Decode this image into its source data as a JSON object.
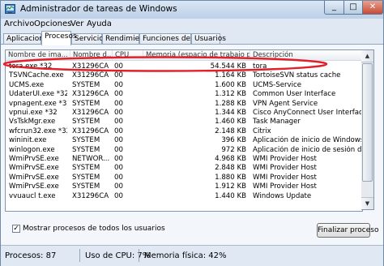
{
  "window": {
    "title": "Administrador de tareas de Windows",
    "controls": [
      "_",
      "□",
      "✕"
    ]
  },
  "menu": [
    "Archivo",
    "Opciones",
    "Ver",
    "Ayuda"
  ],
  "tabs": [
    {
      "label": "Aplicaciones",
      "active": false
    },
    {
      "label": "Procesos",
      "active": true
    },
    {
      "label": "Servicios",
      "active": false
    },
    {
      "label": "Rendimiento",
      "active": false
    },
    {
      "label": "Funciones de red",
      "active": false
    },
    {
      "label": "Usuarios",
      "active": false
    }
  ],
  "columns": [
    "Nombre de ima...",
    "Nombre d...",
    "CPU",
    "Memoria (espacio de trabajo privado)",
    "Descripción"
  ],
  "processes": [
    {
      "name": "tora.exe *32",
      "user": "X31296CA",
      "cpu": "00",
      "memory": "54.544 KB",
      "description": "tora",
      "circled": true
    },
    {
      "name": "TSVNCache.exe",
      "user": "X31296CA",
      "cpu": "00",
      "memory": "1.164 KB",
      "description": "TortoiseSVN status cache"
    },
    {
      "name": "UCMS.exe",
      "user": "SYSTEM",
      "cpu": "00",
      "memory": "1.600 KB",
      "description": "UCMS-Service"
    },
    {
      "name": "UdaterUI.exe *32",
      "user": "X31296CA",
      "cpu": "00",
      "memory": "1.312 KB",
      "description": "Common User Interface"
    },
    {
      "name": "vpnagent.exe *32",
      "user": "SYSTEM",
      "cpu": "00",
      "memory": "1.288 KB",
      "description": "VPN Agent Service"
    },
    {
      "name": "vpnui.exe *32",
      "user": "X31296CA",
      "cpu": "00",
      "memory": "1.344 KB",
      "description": "Cisco AnyConnect User Interface"
    },
    {
      "name": "VsTskMgr.exe",
      "user": "SYSTEM",
      "cpu": "00",
      "memory": "1.460 KB",
      "description": "Task Manager"
    },
    {
      "name": "wfcrun32.exe *32",
      "user": "X31296CA",
      "cpu": "00",
      "memory": "2.148 KB",
      "description": "Citrix"
    },
    {
      "name": "wininit.exe",
      "user": "SYSTEM",
      "cpu": "00",
      "memory": "396 KB",
      "description": "Aplicación de inicio de Windows"
    },
    {
      "name": "winlogon.exe",
      "user": "SYSTEM",
      "cpu": "00",
      "memory": "972 KB",
      "description": "Aplicación de inicio de sesión de Windows"
    },
    {
      "name": "WmiPrvSE.exe",
      "user": "NETWOR...",
      "cpu": "00",
      "memory": "4.968 KB",
      "description": "WMI Provider Host"
    },
    {
      "name": "WmiPrvSE.exe",
      "user": "SYSTEM",
      "cpu": "00",
      "memory": "2.848 KB",
      "description": "WMI Provider Host"
    },
    {
      "name": "WmiPrvSE.exe",
      "user": "SYSTEM",
      "cpu": "00",
      "memory": "1.880 KB",
      "description": "WMI Provider Host"
    },
    {
      "name": "WmiPrvSE.exe",
      "user": "SYSTEM",
      "cpu": "00",
      "memory": "1.912 KB",
      "description": "WMI Provider Host"
    },
    {
      "name": "vvuaucl t.exe",
      "user": "X31296CA",
      "cpu": "00",
      "memory": "1.440 KB",
      "description": "Windows Update"
    }
  ],
  "show_all_checkbox": {
    "label": "Mostrar procesos de todos los usuarios",
    "checked": true,
    "mark": "✓"
  },
  "end_process_button": "Finalizar proceso",
  "status": {
    "processes": "Procesos: 87",
    "cpu": "Uso de CPU: 7%",
    "memory": "Memoria física: 42%"
  },
  "colors": {
    "annotation_circle": "#e0202a",
    "title_bar": "#c9dbee",
    "selection_text": "#000000"
  }
}
